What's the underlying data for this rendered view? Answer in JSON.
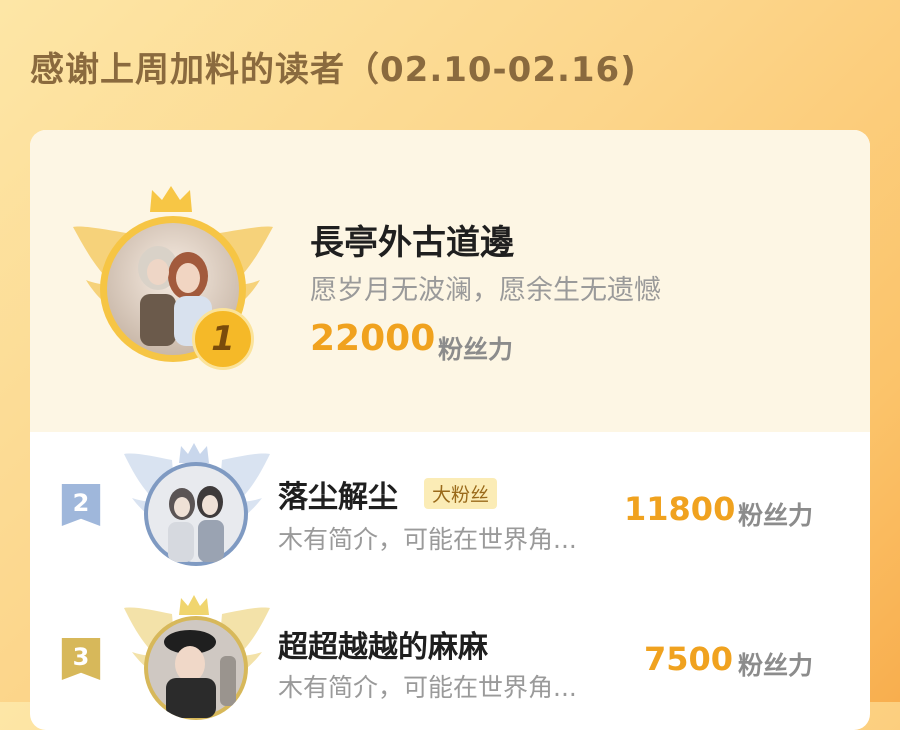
{
  "heading": "感谢上周加料的读者（02.10-02.16)",
  "top_reader": {
    "rank": "1",
    "name": "長亭外古道邊",
    "bio": "愿岁月无波澜，愿余生无遗憾",
    "score": "22000",
    "unit": "粉丝力"
  },
  "readers": [
    {
      "rank": "2",
      "name": "落尘解尘",
      "badge": "大粉丝",
      "bio": "木有简介，可能在世界角...",
      "score": "11800",
      "unit": "粉丝力"
    },
    {
      "rank": "3",
      "name": "超超越越的麻麻",
      "bio": "木有简介，可能在世界角...",
      "score": "7500",
      "unit": "粉丝力"
    }
  ],
  "colors": {
    "accent": "#f0a21f",
    "rank2": "#9fb7db",
    "rank3": "#d7b85a"
  }
}
